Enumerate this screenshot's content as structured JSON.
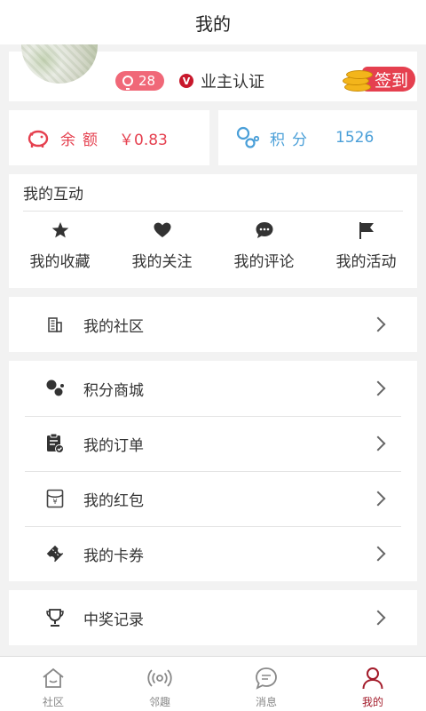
{
  "header": {
    "title": "我的"
  },
  "profile": {
    "level": "28",
    "owner_verify": "业主认证",
    "v_mark": "V",
    "signin_label": "签到"
  },
  "assets": {
    "balance": {
      "label": "余额",
      "value": "￥0.83"
    },
    "points": {
      "label": "积分",
      "value": "1526"
    }
  },
  "interact": {
    "title": "我的互动",
    "items": [
      {
        "label": "我的收藏",
        "icon": "star-icon"
      },
      {
        "label": "我的关注",
        "icon": "heart-icon"
      },
      {
        "label": "我的评论",
        "icon": "comment-icon"
      },
      {
        "label": "我的活动",
        "icon": "flag-icon"
      }
    ]
  },
  "menu": {
    "community": {
      "label": "我的社区",
      "icon": "building-icon"
    },
    "points_mall": {
      "label": "积分商城",
      "icon": "dots-icon"
    },
    "orders": {
      "label": "我的订单",
      "icon": "clipboard-icon"
    },
    "red_packets": {
      "label": "我的红包",
      "icon": "red-packet-icon"
    },
    "coupons": {
      "label": "我的卡券",
      "icon": "ticket-icon"
    },
    "prizes": {
      "label": "中奖记录",
      "icon": "trophy-icon"
    }
  },
  "tabbar": {
    "items": [
      {
        "label": "社区",
        "icon": "home-icon"
      },
      {
        "label": "邻趣",
        "icon": "broadcast-icon"
      },
      {
        "label": "消息",
        "icon": "chat-icon"
      },
      {
        "label": "我的",
        "icon": "user-icon",
        "active": true
      }
    ]
  },
  "colors": {
    "accent": "#e5404f",
    "points": "#4a9fd8",
    "active_tab": "#a31b2a"
  }
}
